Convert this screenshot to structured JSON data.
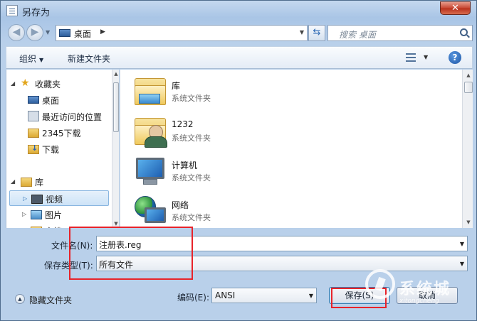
{
  "window": {
    "title": "另存为",
    "close_label": "✕"
  },
  "nav": {
    "back_glyph": "◀",
    "forward_glyph": "▶",
    "address_location": "桌面",
    "search_placeholder": "搜索 桌面"
  },
  "toolbar": {
    "organize_label": "组织",
    "new_folder_label": "新建文件夹",
    "help_label": "?"
  },
  "sidebar": {
    "items": [
      {
        "label": "收藏夹",
        "icon": "star-icon"
      },
      {
        "label": "桌面",
        "icon": "desktop-icon"
      },
      {
        "label": "最近访问的位置",
        "icon": "recent-places-icon"
      },
      {
        "label": "2345下载",
        "icon": "folder-icon"
      },
      {
        "label": "下载",
        "icon": "downloads-icon"
      },
      {
        "label": "库",
        "icon": "library-icon"
      },
      {
        "label": "视频",
        "icon": "video-icon"
      },
      {
        "label": "图片",
        "icon": "pictures-icon"
      },
      {
        "label": "文档",
        "icon": "documents-icon"
      }
    ]
  },
  "files": [
    {
      "name": "库",
      "type": "系统文件夹",
      "icon": "library-folder-icon"
    },
    {
      "name": "1232",
      "type": "系统文件夹",
      "icon": "user-folder-icon"
    },
    {
      "name": "计算机",
      "type": "系统文件夹",
      "icon": "computer-icon"
    },
    {
      "name": "网络",
      "type": "系统文件夹",
      "icon": "network-icon"
    }
  ],
  "form": {
    "filename_label": "文件名(N):",
    "filename_value": "注册表.reg",
    "filetype_label": "保存类型(T):",
    "filetype_value": "所有文件",
    "encoding_label": "编码(E):",
    "encoding_value": "ANSI"
  },
  "footer": {
    "hide_folders_label": "隐藏文件夹",
    "save_label": "保存(S)",
    "cancel_label": "取消"
  },
  "watermark": {
    "text": "系统城",
    "subtext": "xitongcheng"
  },
  "colors": {
    "highlight": "#e8232a",
    "accent": "#3c7fb1"
  }
}
